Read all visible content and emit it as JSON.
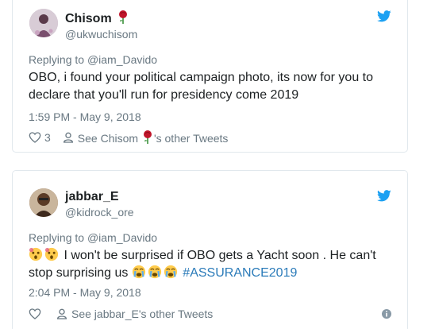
{
  "tweets": [
    {
      "name": "Chisom",
      "name_emoji": "rose-icon",
      "handle": "@ukwuchisom",
      "replying_label": "Replying to",
      "replying_to": "@iam_Davido",
      "text": "OBO, i found your political campaign photo, its now for you to declare that you'll run for presidency come 2019",
      "timestamp": "1:59 PM - May 9, 2018",
      "likes": "3",
      "other_tweets_prefix": "See Chisom",
      "other_tweets_suffix": "'s other Tweets"
    },
    {
      "name": "jabbar_E",
      "handle": "@kidrock_ore",
      "replying_label": "Replying to",
      "replying_to": "@iam_Davido",
      "text_main": "I won't be surprised if OBO gets a Yacht soon . He can't stop surprising us",
      "hashtag": "#ASSURANCE2019",
      "timestamp": "2:04 PM - May 9, 2018",
      "other_tweets": "See jabbar_E's other Tweets"
    }
  ],
  "colors": {
    "twitter_blue": "#1da1f2",
    "link": "#2b7bb9",
    "muted": "#697882",
    "border": "#e1e8ed",
    "rose": "#c0152a"
  }
}
